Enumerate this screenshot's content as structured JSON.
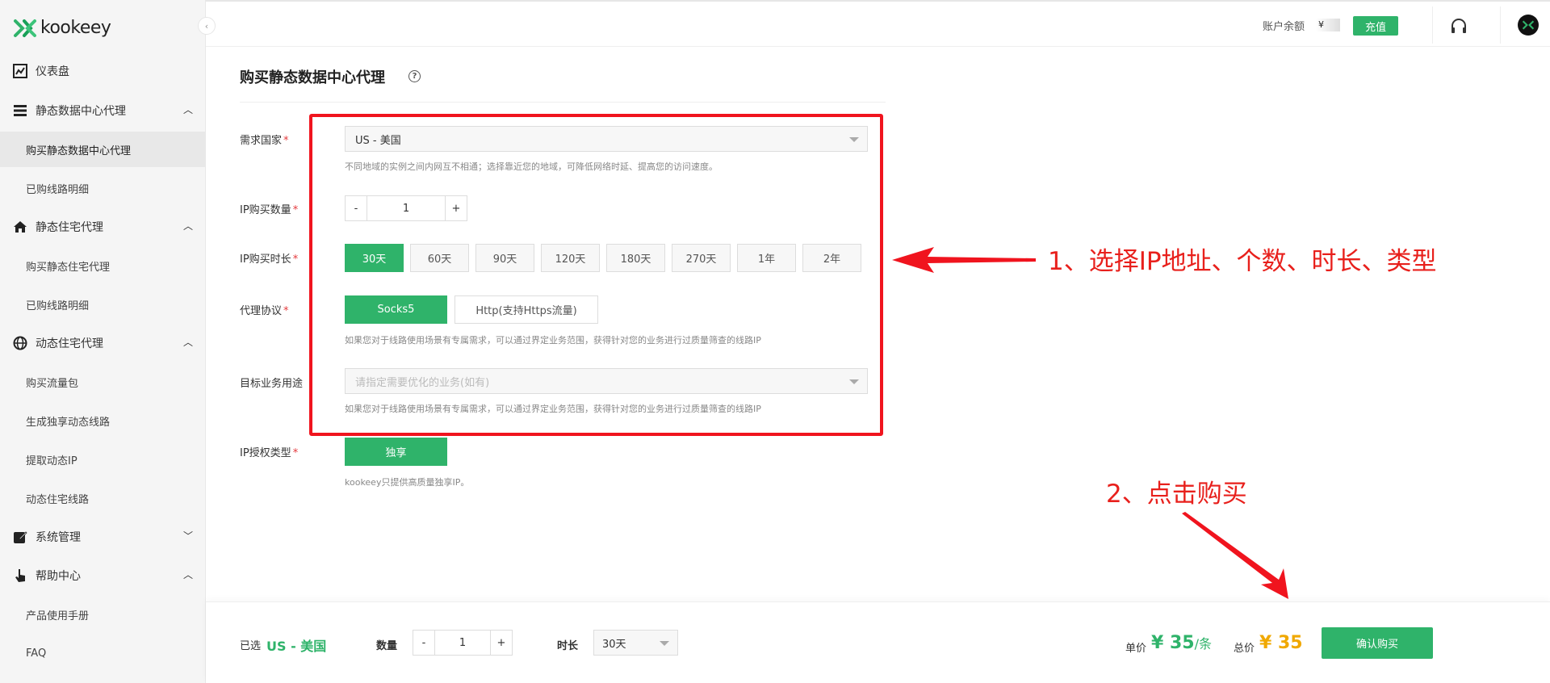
{
  "colors": {
    "brand_green": "#2fb36a",
    "price_orange": "#f0a800",
    "annotation_red": "#f0141e",
    "required_red": "#e4393c"
  },
  "sidebar": {
    "logo_text": "kookeey",
    "menu": [
      {
        "label": "仪表盘",
        "icon": "dashboard-chart-icon"
      },
      {
        "label": "静态数据中心代理",
        "icon": "server-list-icon",
        "expanded": true,
        "children": [
          {
            "label": "购买静态数据中心代理",
            "active": true
          },
          {
            "label": "已购线路明细"
          }
        ]
      },
      {
        "label": "静态住宅代理",
        "icon": "home-icon",
        "expanded": true,
        "children": [
          {
            "label": "购买静态住宅代理"
          },
          {
            "label": "已购线路明细"
          }
        ]
      },
      {
        "label": "动态住宅代理",
        "icon": "globe-icon",
        "expanded": true,
        "children": [
          {
            "label": "购买流量包"
          },
          {
            "label": "生成独享动态线路"
          },
          {
            "label": "提取动态IP"
          },
          {
            "label": "动态住宅线路"
          }
        ]
      },
      {
        "label": "系统管理",
        "icon": "edit-icon",
        "expanded": false
      },
      {
        "label": "帮助中心",
        "icon": "hand-pointer-icon",
        "expanded": true,
        "children": [
          {
            "label": "产品使用手册"
          },
          {
            "label": "FAQ"
          }
        ]
      }
    ]
  },
  "topbar": {
    "balance_label": "账户余额",
    "balance_value": "¥",
    "recharge_label": "充值"
  },
  "page": {
    "title": "购买静态数据中心代理",
    "help_icon_glyph": "?"
  },
  "form": {
    "country": {
      "label": "需求国家",
      "value": "US - 美国",
      "hint": "不同地域的实例之间内网互不相通；选择靠近您的地域，可降低网络时延、提高您的访问速度。"
    },
    "quantity": {
      "label": "IP购买数量",
      "minus": "-",
      "value": "1",
      "plus": "+"
    },
    "duration": {
      "label": "IP购买时长",
      "options": [
        "30天",
        "60天",
        "90天",
        "120天",
        "180天",
        "270天",
        "1年",
        "2年"
      ],
      "selected_index": 0
    },
    "protocol": {
      "label": "代理协议",
      "options": [
        "Socks5",
        "Http(支持Https流量)"
      ],
      "selected_index": 0,
      "hint": "如果您对于线路使用场景有专属需求，可以通过界定业务范围，获得针对您的业务进行过质量筛查的线路IP"
    },
    "purpose": {
      "label": "目标业务用途",
      "placeholder": "请指定需要优化的业务(如有)",
      "hint": "如果您对于线路使用场景有专属需求，可以通过界定业务范围，获得针对您的业务进行过质量筛查的线路IP"
    },
    "auth_type": {
      "label": "IP授权类型",
      "option": "独享",
      "hint": "kookeey只提供高质量独享IP。"
    },
    "required_mark": "*"
  },
  "annotations": {
    "step1": "1、选择IP地址、个数、时长、类型",
    "step2": "2、点击购买"
  },
  "bottom_bar": {
    "selected_label": "已选",
    "selected_value": "US - 美国",
    "quantity_label": "数量",
    "quantity_minus": "-",
    "quantity_value": "1",
    "quantity_plus": "+",
    "duration_label": "时长",
    "duration_value": "30天",
    "unit_price_label": "单价",
    "unit_price": "¥ 35",
    "unit_price_suffix": "/条",
    "total_price_label": "总价",
    "total_price": "¥ 35",
    "confirm_label": "确认购买"
  }
}
